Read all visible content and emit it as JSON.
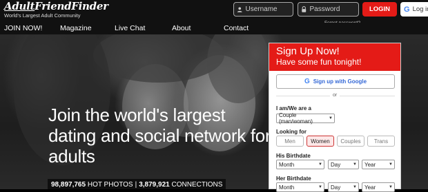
{
  "brand": {
    "logo_prefix": "Adult",
    "logo_suffix": "FriendFinder",
    "tagline": "World's Largest Adult Community"
  },
  "login": {
    "username_placeholder": "Username",
    "password_placeholder": "Password",
    "login_label": "LOGIN",
    "google_login_label": "Log in",
    "forgot_label": "Forgot password?"
  },
  "nav": {
    "items": [
      "JOIN NOW!",
      "Magazine",
      "Live Chat",
      "About",
      "Contact"
    ]
  },
  "hero": {
    "headline": "Join the world's largest dating and social network for adults",
    "stats": {
      "photos_count": "98,897,765",
      "photos_label": "HOT PHOTOS",
      "separator": "|",
      "connections_count": "3,879,921",
      "connections_label": "CONNECTIONS"
    }
  },
  "signup": {
    "title": "Sign Up Now!",
    "subtitle": "Have some fun tonight!",
    "google_button": "Sign up with Google",
    "or_text": "or",
    "iam_label": "I am/We are a",
    "iam_value": "Couple (man/woman)",
    "looking_for_label": "Looking for",
    "looking_for_options": [
      "Men",
      "Women",
      "Couples",
      "Trans"
    ],
    "looking_for_selected": "Women",
    "his_birthdate_label": "His Birthdate",
    "her_birthdate_label": "Her Birthdate",
    "month_placeholder": "Month",
    "day_placeholder": "Day",
    "year_placeholder": "Year"
  },
  "colors": {
    "accent": "#e41b17",
    "topbar": "#111111",
    "google_blue": "#4285f4"
  }
}
